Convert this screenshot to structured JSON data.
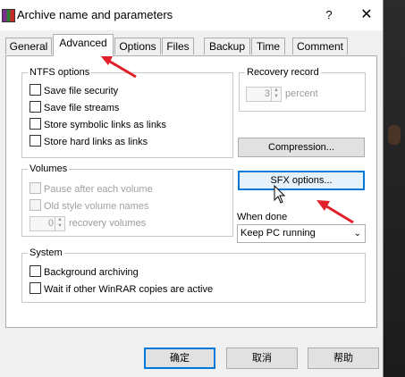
{
  "dialog": {
    "title": "Archive name and parameters",
    "help_label": "?",
    "close_label": "✕"
  },
  "tabs": [
    {
      "label": "General"
    },
    {
      "label": "Advanced",
      "active": true
    },
    {
      "label": "Options"
    },
    {
      "label": "Files"
    },
    {
      "label": "Backup"
    },
    {
      "label": "Time"
    },
    {
      "label": "Comment"
    }
  ],
  "ntfs": {
    "legend": "NTFS options",
    "items": [
      {
        "label": "Save file security",
        "checked": false
      },
      {
        "label": "Save file streams",
        "checked": false
      },
      {
        "label": "Store symbolic links as links",
        "checked": false
      },
      {
        "label": "Store hard links as links",
        "checked": false
      }
    ]
  },
  "recovery": {
    "legend": "Recovery record",
    "value": "3",
    "unit": "percent"
  },
  "compression_button": "Compression...",
  "sfx_button": "SFX options...",
  "volumes": {
    "legend": "Volumes",
    "pause_label": "Pause after each volume",
    "old_style_label": "Old style volume names",
    "recovery_value": "0",
    "recovery_unit": "recovery volumes"
  },
  "when_done": {
    "label": "When done",
    "selected": "Keep PC running"
  },
  "system": {
    "legend": "System",
    "background_label": "Background archiving",
    "wait_label": "Wait if other WinRAR copies are active"
  },
  "footer": {
    "ok": "确定",
    "cancel": "取消",
    "help": "帮助"
  },
  "colors": {
    "annotation_arrow": "#e0202a",
    "focus_border": "#0078d7"
  }
}
